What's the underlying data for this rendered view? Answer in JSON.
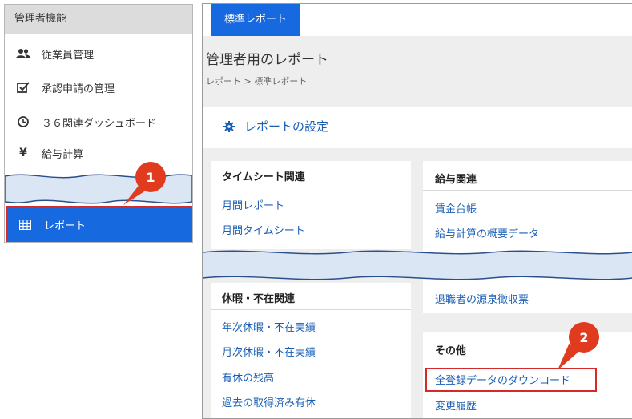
{
  "colors": {
    "accent": "#1769e0",
    "link": "#1a5fb4",
    "highlight": "#d42a2a",
    "badge": "#e03a1f"
  },
  "sidebar": {
    "header": "管理者機能",
    "items": [
      {
        "label": "従業員管理",
        "icon": "people-icon"
      },
      {
        "label": "承認申請の管理",
        "icon": "checkbox-icon"
      },
      {
        "label": "３６関連ダッシュボード",
        "icon": "clock-icon"
      },
      {
        "label": "給与計算",
        "icon": "yen-icon"
      }
    ],
    "report": {
      "label": "レポート",
      "icon": "table-icon"
    }
  },
  "badges": {
    "first": "1",
    "second": "2"
  },
  "main": {
    "tab": "標準レポート",
    "title": "管理者用のレポート",
    "breadcrumb": "レポート > 標準レポート",
    "settings_link": "レポートの設定",
    "sections": {
      "timesheet": {
        "title": "タイムシート関連",
        "links": [
          "月間レポート",
          "月間タイムシート"
        ]
      },
      "payroll": {
        "title": "給与関連",
        "links": [
          "賃金台帳",
          "給与計算の概要データ",
          "退職者の源泉徴収票"
        ]
      },
      "leave": {
        "title": "休暇・不在関連",
        "links": [
          "年次休暇・不在実績",
          "月次休暇・不在実績",
          "有休の残高",
          "過去の取得済み有休"
        ]
      },
      "other": {
        "title": "その他",
        "links": [
          "全登録データのダウンロード",
          "変更履歴"
        ]
      }
    }
  }
}
